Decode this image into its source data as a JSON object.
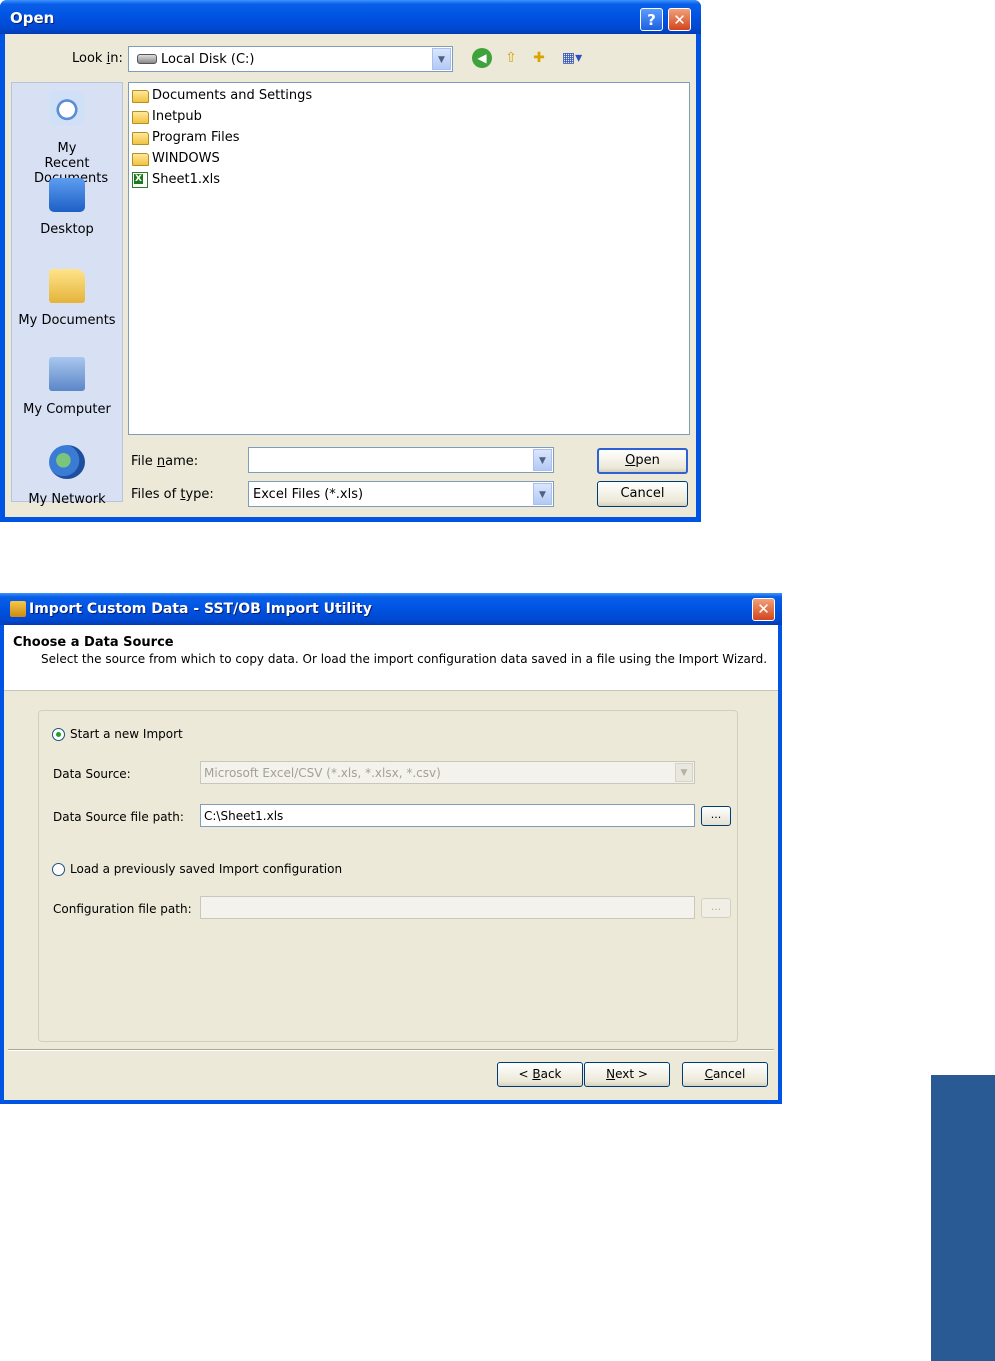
{
  "open_dialog": {
    "title": "Open",
    "help_label": "?",
    "close_label": "✕",
    "look_in": {
      "label": "Look in:",
      "value": "Local Disk (C:)"
    },
    "toolbar": {
      "back_glyph": "◀",
      "up_glyph": "⇧",
      "newfolder_glyph": "✚",
      "views_glyph": "▦▾"
    },
    "places": [
      {
        "label": "My Recent Documents"
      },
      {
        "label": "Desktop"
      },
      {
        "label": "My Documents"
      },
      {
        "label": "My Computer"
      },
      {
        "label": "My Network"
      }
    ],
    "files": [
      {
        "name": "Documents and Settings",
        "type": "folder"
      },
      {
        "name": "Inetpub",
        "type": "folder"
      },
      {
        "name": "Program Files",
        "type": "folder"
      },
      {
        "name": "WINDOWS",
        "type": "folder"
      },
      {
        "name": "Sheet1.xls",
        "type": "excel"
      }
    ],
    "file_name": {
      "label": "File name:",
      "value": ""
    },
    "files_of_type": {
      "label": "Files of type:",
      "value": "Excel Files (*.xls)"
    },
    "open_label": "Open",
    "cancel_label": "Cancel"
  },
  "wizard": {
    "title": "Import Custom Data - SST/OB Import Utility",
    "close_label": "✕",
    "heading": "Choose a Data Source",
    "subheading": "Select the source from which to copy data. Or load the import configuration data saved in a file using the Import Wizard.",
    "start_new_label": "Start a new Import",
    "data_source_label": "Data Source:",
    "data_source_value": "Microsoft Excel/CSV  (*.xls, *.xlsx, *.csv)",
    "ds_path_label": "Data Source file path:",
    "ds_path_value": "C:\\Sheet1.xls",
    "browse_label": "...",
    "load_label": "Load a previously saved Import configuration",
    "config_path_label": "Configuration file path:",
    "config_path_value": "",
    "back_label": "< Back",
    "next_label": "Next >",
    "cancel_label": "Cancel"
  },
  "colors": {
    "xp_title_blue": "#0054e3",
    "dialog_face": "#ece9d8",
    "side_tab": "#2a5a94"
  }
}
